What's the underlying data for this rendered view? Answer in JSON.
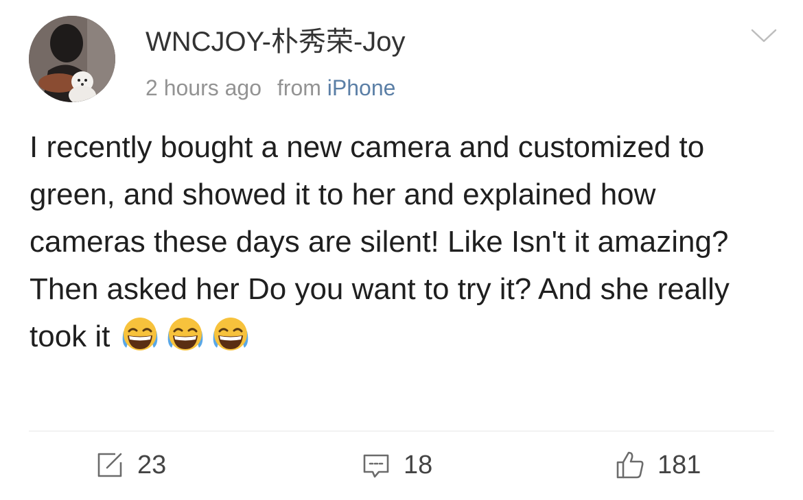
{
  "post": {
    "username": "WNCJOY-朴秀荣-Joy",
    "time": "2 hours ago",
    "from_label": "from",
    "source": "iPhone",
    "body_line1": "I recently bought a new camera and customized to green, and showed it to her and explained how cameras these days are silent! Like Isn't it amazing?",
    "body_line2": "Then asked her Do you want to try it? And she really took it",
    "emojis": [
      "laughing-crying-emoji",
      "laughing-crying-emoji",
      "laughing-crying-emoji"
    ]
  },
  "actions": {
    "repost_count": "23",
    "comment_count": "18",
    "like_count": "181"
  },
  "icons": {
    "avatar": "avatar",
    "menu": "chevron-down-icon",
    "repost": "repost-icon",
    "comment": "comment-icon",
    "like": "thumbs-up-icon"
  },
  "colors": {
    "source_link": "#5b7fa6",
    "meta_text": "#939393",
    "body_text": "#1f1f1f",
    "divider": "#e6e6e6"
  }
}
